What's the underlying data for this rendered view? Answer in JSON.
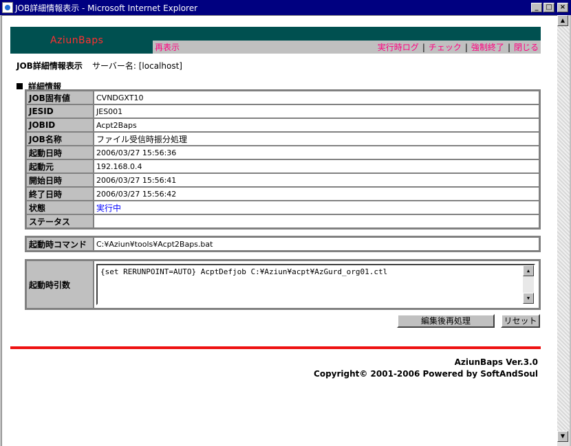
{
  "window": {
    "title": "JOB詳細情報表示 - Microsoft Internet Explorer",
    "minimize": "_",
    "maximize": "□",
    "close": "×"
  },
  "header": {
    "logo": "AziunBaps",
    "refresh": "再表示",
    "nav": [
      "実行時ログ",
      "チェック",
      "強制終了",
      "閉じる"
    ],
    "separator": "|"
  },
  "page": {
    "title": "JOB詳細情報表示",
    "server": "サーバー名: [localhost]",
    "section": "詳細情報"
  },
  "details": [
    {
      "label": "JOB固有値",
      "value": "CVNDGXT10"
    },
    {
      "label": "JESID",
      "value": "JES001"
    },
    {
      "label": "JOBID",
      "value": "Acpt2Baps"
    },
    {
      "label": "JOB名称",
      "value": "ファイル受信時振分処理"
    },
    {
      "label": "起動日時",
      "value": "2006/03/27 15:56:36"
    },
    {
      "label": "起動元",
      "value": "192.168.0.4"
    },
    {
      "label": "開始日時",
      "value": "2006/03/27 15:56:41"
    },
    {
      "label": "終了日時",
      "value": "2006/03/27 15:56:42"
    },
    {
      "label": "状態",
      "value": "実行中"
    },
    {
      "label": "ステータス",
      "value": ""
    }
  ],
  "command": {
    "label": "起動時コマンド",
    "value": "C:¥Aziun¥tools¥Acpt2Baps.bat"
  },
  "args": {
    "label": "起動時引数",
    "value": "{set RERUNPOINT=AUTO} AcptDefjob C:¥Aziun¥acpt¥AzGurd_org01.ctl"
  },
  "buttons": {
    "reprocess": "編集後再処理",
    "reset": "リセット"
  },
  "footer": {
    "version": "AziunBaps Ver.3.0",
    "copyright": "Copyright© 2001-2006 Powered by SoftAndSoul"
  },
  "colors": {
    "header_dark": "#005050",
    "logo": "#ff3030",
    "nav_link": "#ff0080",
    "rule": "#ee1111"
  }
}
